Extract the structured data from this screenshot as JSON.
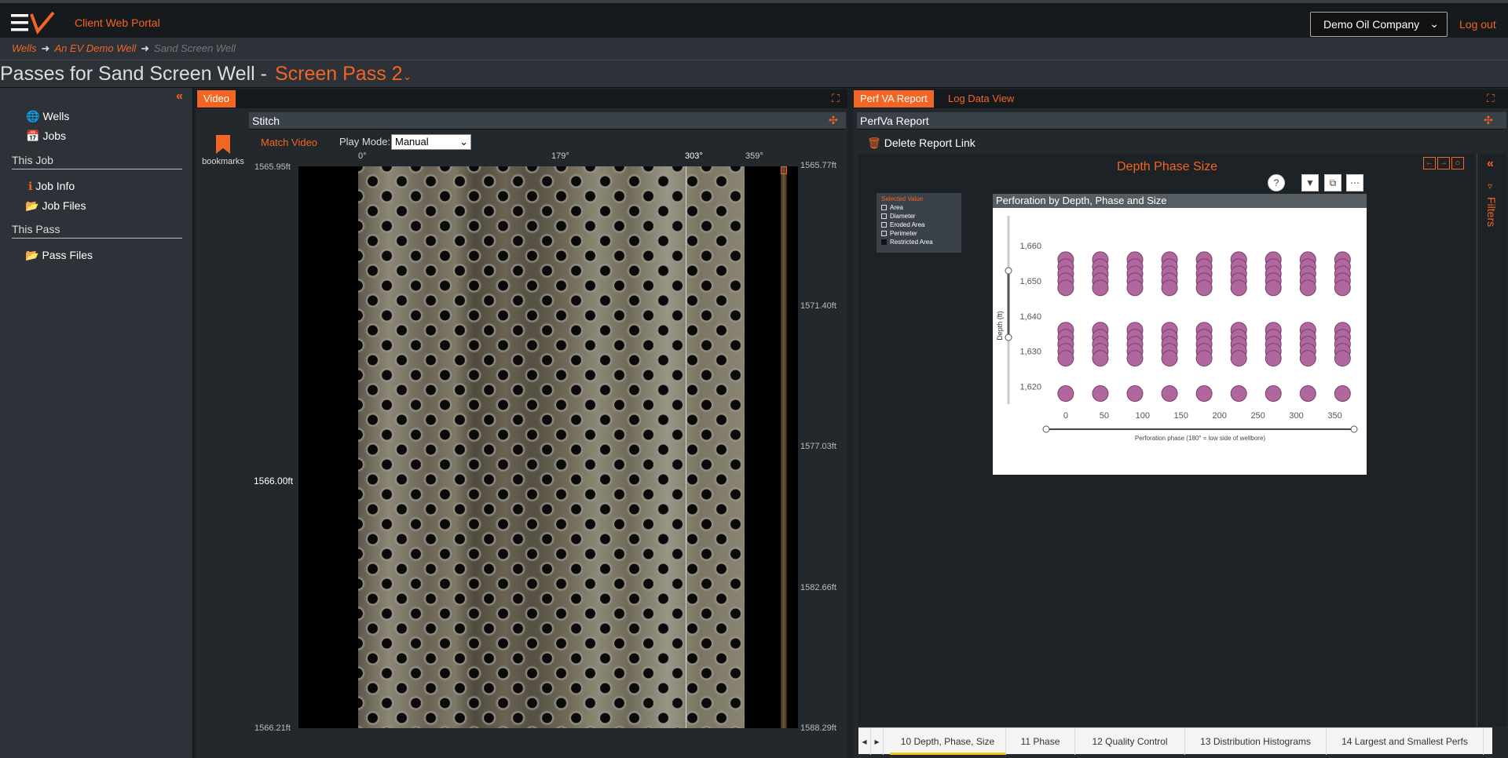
{
  "header": {
    "portal_title": "Client Web Portal",
    "company": "Demo Oil Company",
    "logout": "Log out"
  },
  "breadcrumb": [
    "Wells",
    "An EV Demo Well",
    "Sand Screen Well"
  ],
  "page": {
    "title": "Passes for Sand Screen Well -",
    "pass": "Screen Pass 2"
  },
  "sidebar": {
    "items": [
      "Wells",
      "Jobs"
    ],
    "this_job": {
      "heading": "This Job",
      "items": [
        "Job Info",
        "Job Files"
      ]
    },
    "this_pass": {
      "heading": "This Pass",
      "items": [
        "Pass Files"
      ]
    }
  },
  "video_panel": {
    "tab": "Video",
    "stitch_header": "Stitch",
    "bookmarks": "bookmarks",
    "match_video": "Match Video",
    "play_mode_label": "Play Mode:",
    "play_mode_value": "Manual",
    "degrees": [
      "0°",
      "179°",
      "303°",
      "359°"
    ],
    "left_depths": [
      "1565.95ft",
      "1566.00ft",
      "1566.21ft"
    ],
    "right_depths": [
      "1565.77ft",
      "1571.40ft",
      "1577.03ft",
      "1582.66ft",
      "1588.29ft"
    ]
  },
  "report_panel": {
    "tabs": [
      "Perf VA Report",
      "Log Data View"
    ],
    "header": "PerfVa Report",
    "delete_link": "Delete Report Link",
    "report_title": "Depth Phase Size",
    "filters": "Filters",
    "legend": {
      "title": "Selected Value",
      "items": [
        "Area",
        "Diameter",
        "Eroded Area",
        "Perimeter",
        "Restricted Area"
      ]
    },
    "bottom_tabs": [
      "10 Depth, Phase, Size",
      "11 Phase",
      "12 Quality Control",
      "13 Distribution Histograms",
      "14 Largest and Smallest Perfs"
    ],
    "colors": {
      "accent": "#f26522",
      "marker": "#b0679e"
    }
  },
  "chart_data": {
    "type": "scatter",
    "title": "Perforation by Depth, Phase and Size",
    "xlabel": "Perforation phase (180° = low side of wellbore)",
    "ylabel": "Depth (ft)",
    "xticks": [
      "0",
      "50",
      "100",
      "150",
      "200",
      "250",
      "300",
      "350"
    ],
    "yticks": [
      "1,660",
      "1,650",
      "1,640",
      "1,630",
      "1,620"
    ],
    "xlim": [
      -5,
      375
    ],
    "ylim": [
      1615,
      1664
    ],
    "phases": [
      0,
      45,
      90,
      135,
      180,
      225,
      270,
      315,
      360
    ],
    "depths": [
      1656,
      1654,
      1652,
      1650,
      1648,
      1636,
      1634,
      1632,
      1630,
      1628,
      1618
    ]
  }
}
